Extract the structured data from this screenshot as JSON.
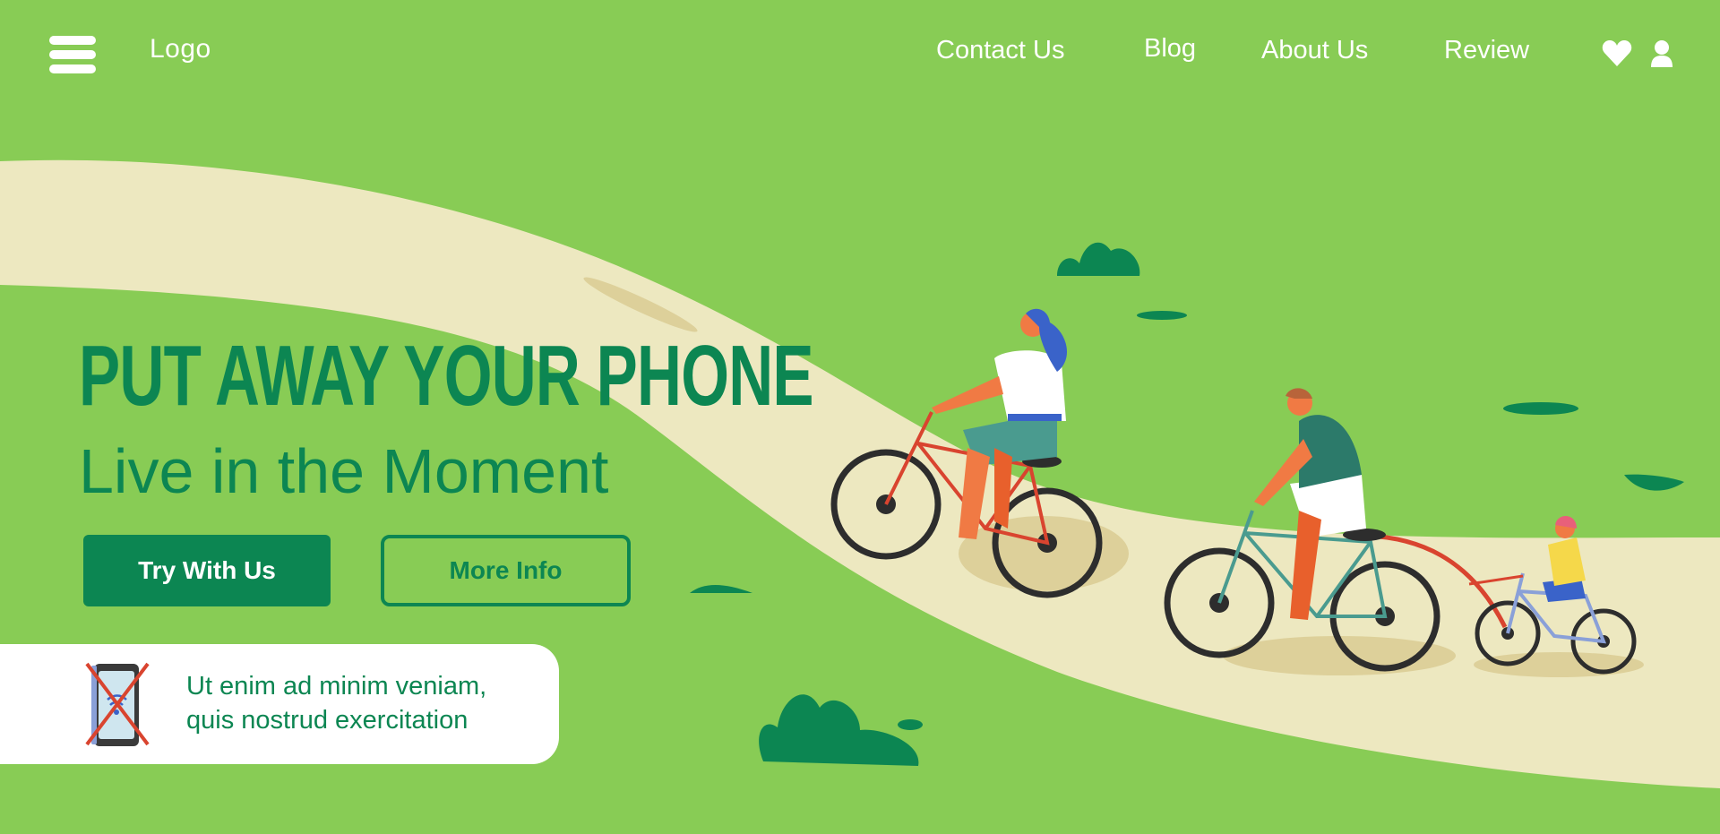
{
  "header": {
    "logo": "Logo",
    "menu_icon": "hamburger-menu-icon",
    "nav": [
      {
        "label": "Contact Us"
      },
      {
        "label": "Blog"
      },
      {
        "label": "About Us"
      },
      {
        "label": "Review"
      }
    ],
    "icons": [
      "heart-icon",
      "user-icon"
    ]
  },
  "hero": {
    "headline": "PUT AWAY YOUR PHONE",
    "subheadline": "Live in the Moment",
    "primary_button": "Try With Us",
    "secondary_button": "More Info"
  },
  "info_card": {
    "icon": "no-phone-icon",
    "line1": "Ut enim ad minim veniam,",
    "line2": "quis nostrud exercitation"
  },
  "colors": {
    "background": "#88cc55",
    "path": "#ede8c0",
    "brand_green": "#0c8652",
    "white": "#ffffff",
    "cross_red": "#d9442f"
  }
}
